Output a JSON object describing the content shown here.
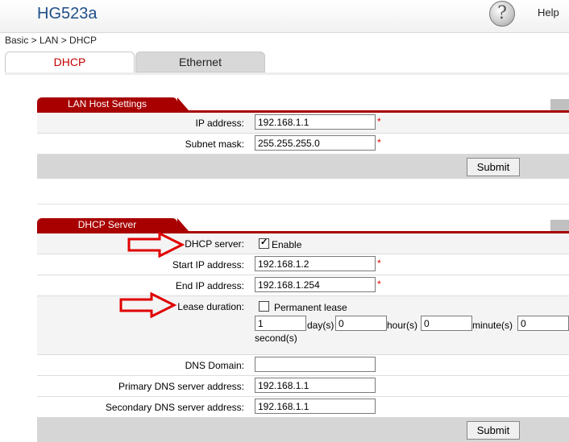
{
  "header": {
    "brand": "HG523a",
    "help_label": "Help",
    "help_icon": "question-mark-icon"
  },
  "breadcrumb": "Basic > LAN > DHCP",
  "tabs": [
    {
      "label": "DHCP",
      "active": true
    },
    {
      "label": "Ethernet",
      "active": false
    }
  ],
  "lan_host": {
    "title": "LAN Host Settings",
    "ip_label": "IP address:",
    "ip_value": "192.168.1.1",
    "mask_label": "Subnet mask:",
    "mask_value": "255.255.255.0",
    "required_mark": "*",
    "submit": "Submit"
  },
  "dhcp_server": {
    "title": "DHCP Server",
    "server_label": "DHCP server:",
    "enable_label": "Enable",
    "enable_checked": true,
    "start_label": "Start IP address:",
    "start_value": "192.168.1.2",
    "end_label": "End IP address:",
    "end_value": "192.168.1.254",
    "lease_label": "Lease duration:",
    "permanent_label": "Permanent lease",
    "permanent_checked": false,
    "days_value": "1",
    "days_unit": "day(s)",
    "hours_value": "0",
    "hours_unit": "hour(s)",
    "minutes_value": "0",
    "minutes_unit": "minute(s)",
    "seconds_value": "0",
    "seconds_unit": "second(s)",
    "dns_domain_label": "DNS Domain:",
    "dns_domain_value": "",
    "primary_dns_label": "Primary DNS server address:",
    "primary_dns_value": "192.168.1.1",
    "secondary_dns_label": "Secondary DNS server address:",
    "secondary_dns_value": "192.168.1.1",
    "required_mark": "*",
    "submit": "Submit"
  },
  "colors": {
    "accent": "#a80000",
    "brand": "#1f4f8a",
    "annotation_arrow": "#e00000"
  }
}
